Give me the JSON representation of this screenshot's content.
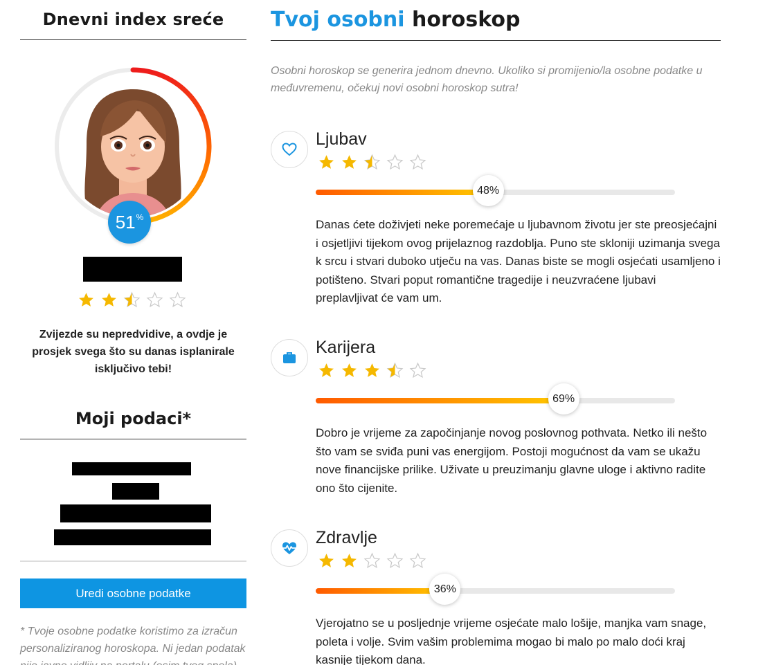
{
  "left": {
    "title": "Dnevni index sreće",
    "happiness_percent": 51,
    "happiness_value": "51",
    "percent_sign": "%",
    "star_rating": 2.5,
    "note": "Zvijezde su nepredvidive, a ovdje je prosjek svega što su danas isplanirale isključivo tebi!",
    "data_title": "Moji podaci*",
    "edit_button": "Uredi osobne podatke",
    "footnote": "* Tvoje osobne podatke koristimo za izračun personaliziranog horoskopa. Ni jedan podatak nije javno vidljiv na portalu (osim tvog spola)."
  },
  "right": {
    "title_part1": "Tvoj osobni",
    "title_part2": "horoskop",
    "intro": "Osobni horoskop se generira jednom dnevno. Ukoliko si promijenio/la osobne podatke u međuvremenu, očekuj novi osobni horoskop sutra!",
    "sections": [
      {
        "name": "Ljubav",
        "icon": "heart-icon",
        "rating": 2.5,
        "percent": 48,
        "percent_label": "48%",
        "text": "Danas ćete doživjeti neke poremećaje u ljubavnom životu jer ste preosjećajni i osjetljivi tijekom ovog prijelaznog razdoblja. Puno ste skloniji uzimanja svega k srcu i stvari duboko utječu na vas. Danas biste se mogli osjećati usamljeno i potišteno. Stvari poput romantične tragedije i neuzvraćene ljubavi preplavljivat će vam um."
      },
      {
        "name": "Karijera",
        "icon": "briefcase-icon",
        "rating": 3.5,
        "percent": 69,
        "percent_label": "69%",
        "text": "Dobro je vrijeme za započinjanje novog poslovnog pothvata. Netko ili nešto što vam se sviđa puni vas energijom. Postoji mogućnost da vam se ukažu nove financijske prilike. Uživate u preuzimanju glavne uloge i aktivno radite ono što cijenite."
      },
      {
        "name": "Zdravlje",
        "icon": "heartbeat-icon",
        "rating": 2,
        "percent": 36,
        "percent_label": "36%",
        "text": "Vjerojatno se u posljednje vrijeme osjećate malo lošije, manjka vam snage, poleta i volje. Svim vašim problemima mogao bi malo po malo doći kraj kasnije tijekom dana."
      }
    ]
  },
  "colors": {
    "accent": "#1b95e0",
    "star": "#f5b800",
    "bar_start": "#ff5a00",
    "bar_end": "#ffc800"
  }
}
